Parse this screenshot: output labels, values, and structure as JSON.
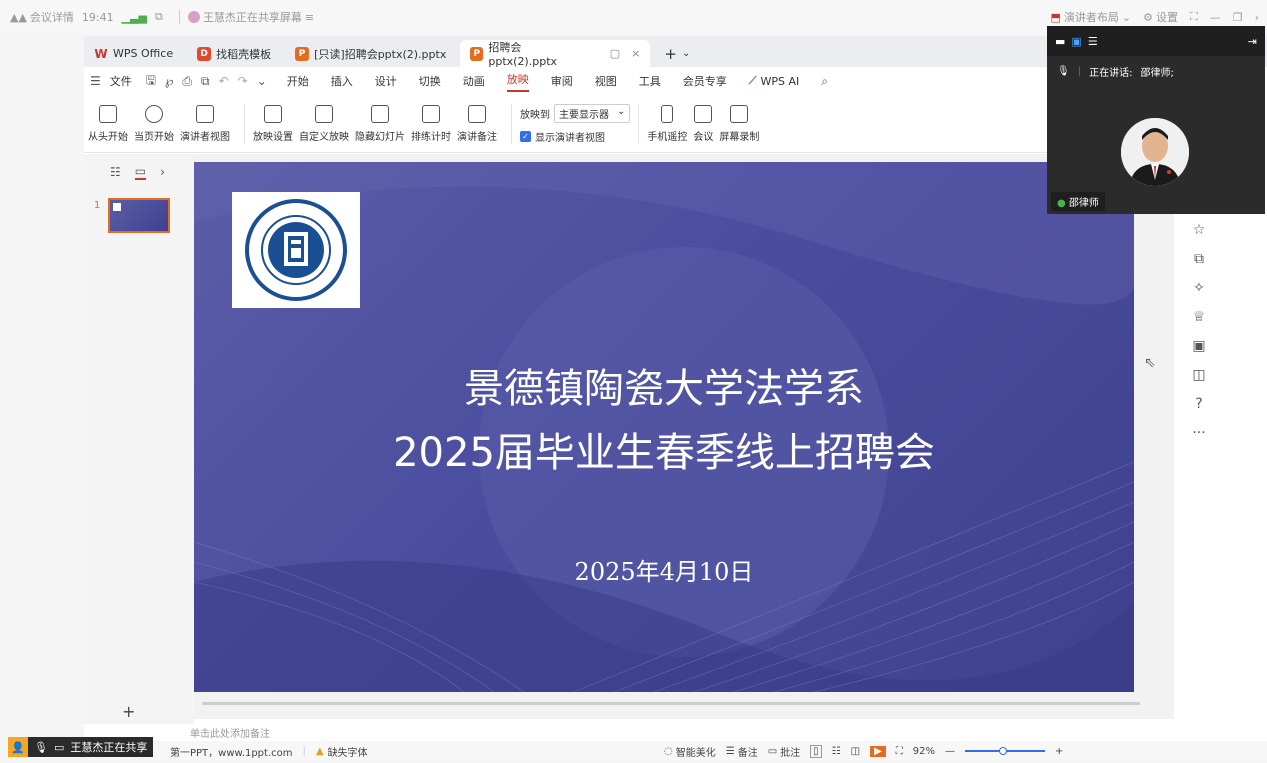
{
  "meeting_bar": {
    "details_label": "会议详情",
    "time": "19:41",
    "sharing_text": "王慧杰正在共享屏幕",
    "presenter_layout_label": "演讲者布局",
    "settings_label": "设置"
  },
  "tabs": [
    {
      "label": "WPS Office",
      "icon": "W",
      "color": "#c7372f"
    },
    {
      "label": "找稻壳模板",
      "icon": "D",
      "color": "#e0492f"
    },
    {
      "label": "[只读]招聘会pptx(2).pptx",
      "icon": "P",
      "color": "#e46c1e"
    },
    {
      "label": "招聘会pptx(2).pptx",
      "icon": "P",
      "color": "#e46c1e"
    }
  ],
  "menu": {
    "file_label": "文件",
    "items": [
      "开始",
      "插入",
      "设计",
      "切换",
      "动画",
      "放映",
      "审阅",
      "视图",
      "工具",
      "会员专享"
    ],
    "active": "放映",
    "wps_ai": "WPS AI"
  },
  "ribbon": {
    "group1": [
      "从头开始",
      "当页开始",
      "演讲者视图"
    ],
    "group2": [
      "放映设置",
      "自定义放映",
      "隐藏幻灯片",
      "排练计时",
      "演讲备注"
    ],
    "play_to_label": "放映到",
    "play_to_value": "主要显示器",
    "show_presenter_view": "显示演讲者视图",
    "group3": [
      "手机遥控",
      "会议",
      "屏幕录制"
    ]
  },
  "thumbnail": {
    "number": "1"
  },
  "slide": {
    "title_line1": "景德镇陶瓷大学法学系",
    "title_line2": "2025届毕业生春季线上招聘会",
    "date": "2025年4月10日",
    "logo_text": "JINGDEZHEN CERAMIC INSTITUTE"
  },
  "notes": {
    "placeholder": "单击此处添加备注"
  },
  "status": {
    "theme_info": "第一PPT，www.1ppt.com",
    "missing_font": "缺失字体",
    "smart_beautify": "智能美化",
    "notes_label": "备注",
    "comments_label": "批注",
    "zoom": "92%"
  },
  "video": {
    "speaking_label": "正在讲话:",
    "speaker": "邵律师;",
    "name": "邵律师"
  },
  "share_badge": {
    "text": "王慧杰正在共享"
  },
  "colors": {
    "accent_red": "#c7372f",
    "slide_bg": "#4a4c9e",
    "orange": "#e46c1e"
  }
}
